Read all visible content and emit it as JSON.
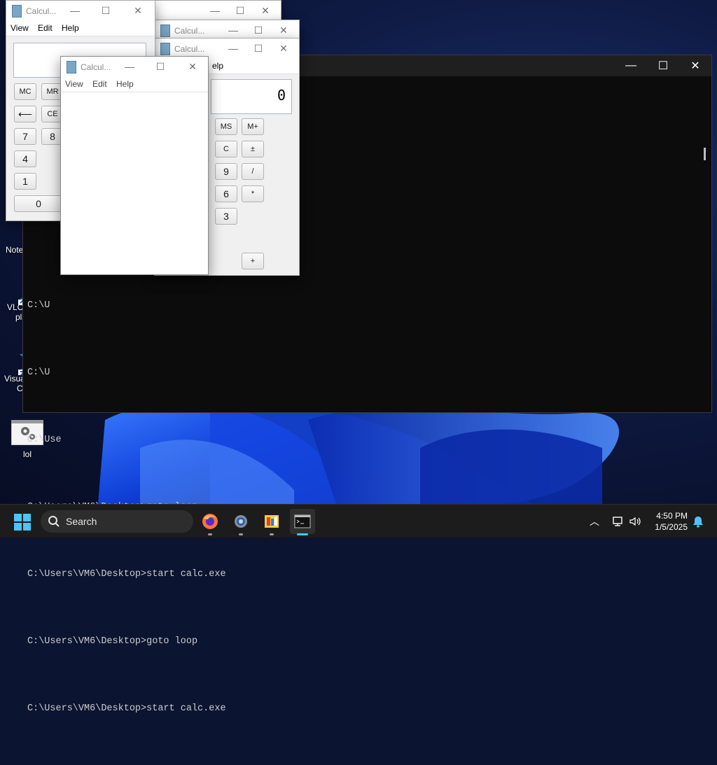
{
  "desktop": {
    "icons": [
      {
        "label": "Notepad",
        "partial": "Note"
      },
      {
        "label": "VLC media player",
        "line1": "VLC m",
        "line2": "pla"
      },
      {
        "label": "Visual Studio Code",
        "line1": "Visual",
        "line2": "Co"
      },
      {
        "label": "lol"
      }
    ]
  },
  "terminal": {
    "controls": {
      "minimize": "—",
      "maximize": "☐",
      "close": "✕"
    },
    "lines": [
      "C:\\U",
      "C:\\U",
      "C:\\Use",
      "C:\\Users\\VM6\\Desktop>goto loop",
      "C:\\Users\\VM6\\Desktop>start calc.exe",
      "C:\\Users\\VM6\\Desktop>goto loop",
      "C:\\Users\\VM6\\Desktop>start calc.exe"
    ]
  },
  "calculator": {
    "title": "Calcul...",
    "menu": [
      "View",
      "Edit",
      "Help"
    ],
    "display": "0",
    "buttons_left": [
      "MC",
      "MR",
      "⟵",
      "CE",
      "7",
      "8",
      "4",
      "1",
      "0"
    ],
    "buttons_right": [
      "MS",
      "M+",
      "C",
      "±",
      "9",
      "/",
      "6",
      "*",
      "3",
      "+"
    ],
    "menu_partial": "elp"
  },
  "taskbar": {
    "search_label": "Search",
    "apps": [
      "firefox-icon",
      "settings-icon",
      "file-explorer-icon",
      "terminal-icon"
    ],
    "time": "4:50 PM",
    "date": "1/5/2025"
  }
}
